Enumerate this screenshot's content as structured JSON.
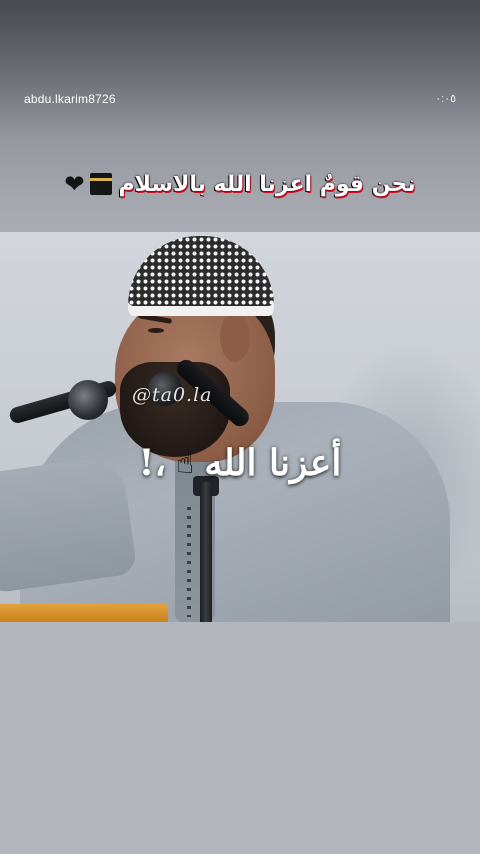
{
  "story": {
    "username": "abdu.lkarim8726",
    "timer": "٠:٠٥",
    "caption": "نحن قومٌ اعزنا الله بالاسلام",
    "caption_emojis": [
      "kaaba-icon",
      "black-heart-icon"
    ]
  },
  "video": {
    "watermark": "@ta0.la",
    "overlay_text": "أعزنا الله",
    "overlay_suffix": "،!",
    "overlay_emoji": "index-pointing-up-icon"
  }
}
